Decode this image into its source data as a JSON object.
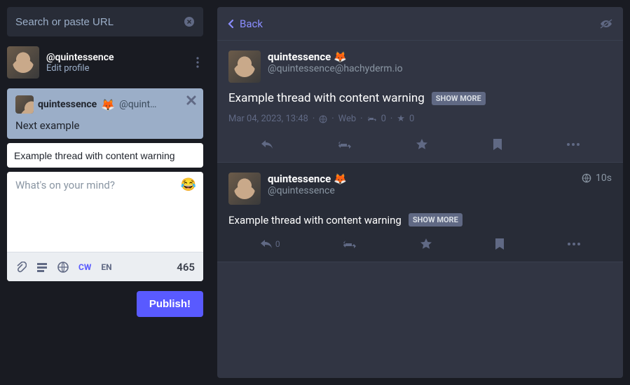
{
  "search": {
    "placeholder": "Search or paste URL"
  },
  "profile": {
    "handle": "@quintessence",
    "edit_label": "Edit profile"
  },
  "compose": {
    "preview": {
      "display_name": "quintessence",
      "emoji": "🦊",
      "handle": "@quint…",
      "body": "Next example"
    },
    "cw_value": "Example thread with content warning",
    "placeholder": "What's on your mind?",
    "toolbar": {
      "cw_label": "CW",
      "lang_label": "EN",
      "char_count": "465"
    },
    "publish_label": "Publish!"
  },
  "header": {
    "back_label": "Back"
  },
  "posts": [
    {
      "display_name": "quintessence",
      "emoji": "🦊",
      "full_handle": "@quintessence@hachyderm.io",
      "text": "Example thread with content warning",
      "show_more": "SHOW MORE",
      "timestamp": "Mar 04, 2023, 13:48",
      "source": "Web",
      "boosts": "0",
      "favs": "0"
    },
    {
      "display_name": "quintessence",
      "emoji": "🦊",
      "short_handle": "@quintessence",
      "age": "10s",
      "text": "Example thread with content warning",
      "show_more": "SHOW MORE",
      "reply_count": "0"
    }
  ]
}
